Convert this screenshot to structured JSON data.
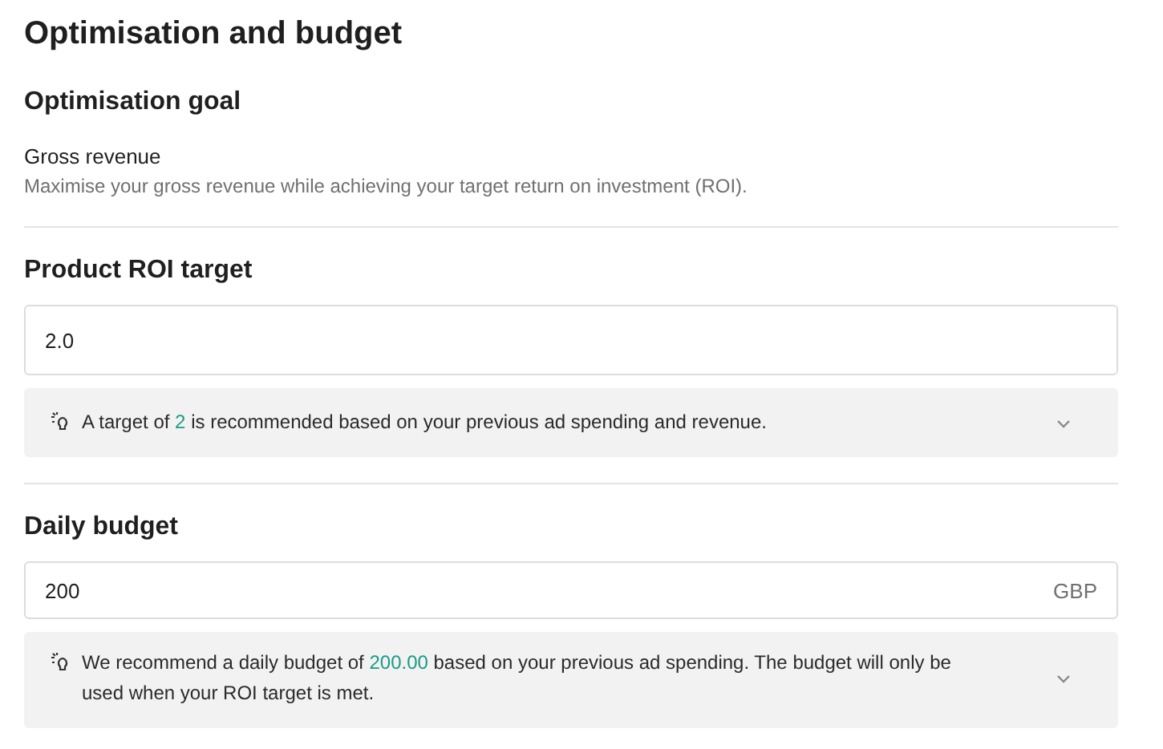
{
  "title": "Optimisation and budget",
  "goal": {
    "heading": "Optimisation goal",
    "name": "Gross revenue",
    "description": "Maximise your gross revenue while achieving your target return on investment (ROI)."
  },
  "roi": {
    "heading": "Product ROI target",
    "value": "2.0",
    "tip": {
      "before": "A target of ",
      "highlight": "2",
      "after": " is recommended based on your previous ad spending and revenue.",
      "expanded": false
    }
  },
  "budget": {
    "heading": "Daily budget",
    "value": "200",
    "currency": "GBP",
    "tip": {
      "before": "We recommend a daily budget of ",
      "highlight": "200.00",
      "after": " based on your previous ad spending. The budget will only be used when your ROI target is met.",
      "expanded": false
    }
  }
}
